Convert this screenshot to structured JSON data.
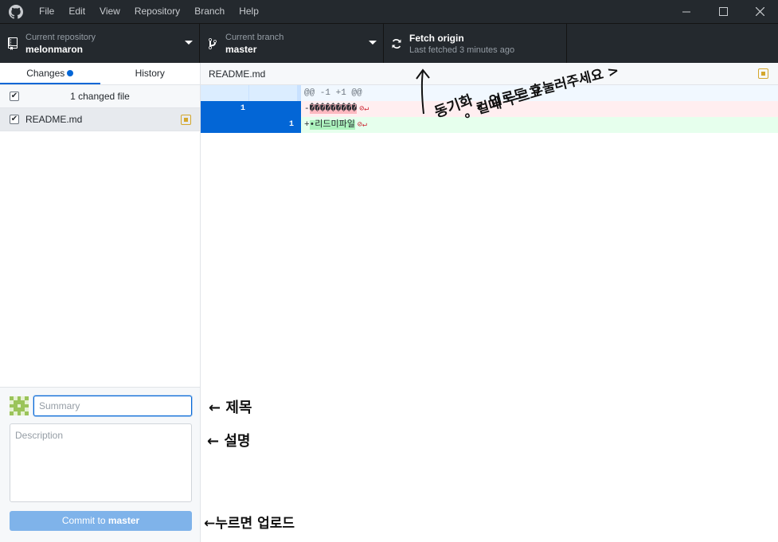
{
  "menu": [
    "File",
    "Edit",
    "View",
    "Repository",
    "Branch",
    "Help"
  ],
  "toolbar": {
    "repo_desc": "Current repository",
    "repo_name": "melonmaron",
    "branch_desc": "Current branch",
    "branch_name": "master",
    "fetch_title": "Fetch origin",
    "fetch_desc": "Last fetched 3 minutes ago"
  },
  "tabs": {
    "changes": "Changes",
    "history": "History"
  },
  "changes": {
    "count_label": "1 changed file",
    "files": [
      {
        "name": "README.md",
        "status": "modified"
      }
    ]
  },
  "commit": {
    "summary_placeholder": "Summary",
    "description_placeholder": "Description",
    "button_prefix": "Commit to ",
    "button_branch": "master"
  },
  "diff": {
    "file": "README.md",
    "hunk_header": "@@ -1 +1 @@",
    "deleted_line": {
      "old_no": "1",
      "prefix": "-",
      "text": "���������"
    },
    "added_line": {
      "new_no": "1",
      "prefix": "+",
      "text": "•리드미파일"
    }
  },
  "annotations": {
    "fetch_note_1": "동기화",
    "fetch_note_2": "。컬때 누르고",
    "fetch_note_3": "。업로드 후눌러주세요 >",
    "summary_note": "← 제목",
    "description_note": "← 설명",
    "commit_note": "←누르면 업로드"
  },
  "colors": {
    "titlebar_bg": "#24292e",
    "accent": "#0366d6",
    "modified": "#d4a72c",
    "commit_button": "#7fb3ea"
  }
}
